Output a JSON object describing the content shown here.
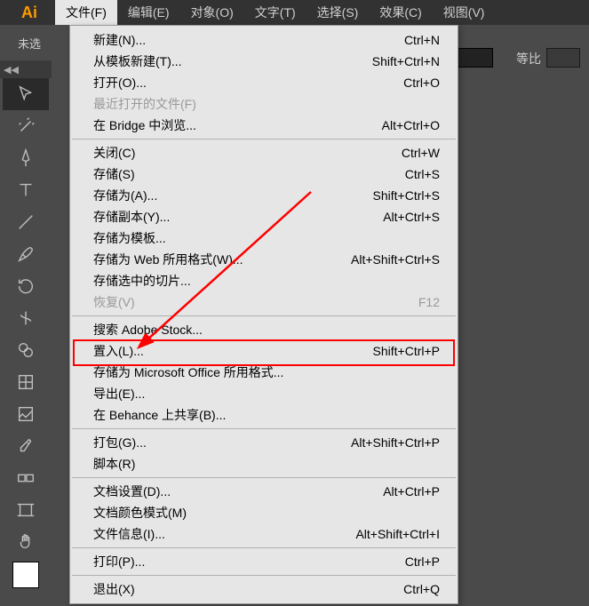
{
  "menubar": {
    "items": [
      "文件(F)",
      "编辑(E)",
      "对象(O)",
      "文字(T)",
      "选择(S)",
      "效果(C)",
      "视图(V)"
    ]
  },
  "secondary": {
    "unselected": "未选",
    "ratio_label": "等比"
  },
  "toolbar_header": "◀◀",
  "dropdown": {
    "items": [
      {
        "label": "新建(N)...",
        "shortcut": "Ctrl+N"
      },
      {
        "label": "从模板新建(T)...",
        "shortcut": "Shift+Ctrl+N"
      },
      {
        "label": "打开(O)...",
        "shortcut": "Ctrl+O"
      },
      {
        "label": "最近打开的文件(F)",
        "shortcut": "",
        "disabled": true
      },
      {
        "label": "在 Bridge 中浏览...",
        "shortcut": "Alt+Ctrl+O"
      },
      {
        "sep": true
      },
      {
        "label": "关闭(C)",
        "shortcut": "Ctrl+W"
      },
      {
        "label": "存储(S)",
        "shortcut": "Ctrl+S"
      },
      {
        "label": "存储为(A)...",
        "shortcut": "Shift+Ctrl+S"
      },
      {
        "label": "存储副本(Y)...",
        "shortcut": "Alt+Ctrl+S"
      },
      {
        "label": "存储为模板...",
        "shortcut": ""
      },
      {
        "label": "存储为 Web 所用格式(W)...",
        "shortcut": "Alt+Shift+Ctrl+S"
      },
      {
        "label": "存储选中的切片...",
        "shortcut": ""
      },
      {
        "label": "恢复(V)",
        "shortcut": "F12",
        "disabled": true
      },
      {
        "sep": true
      },
      {
        "label": "搜索 Adobe Stock...",
        "shortcut": ""
      },
      {
        "label": "置入(L)...",
        "shortcut": "Shift+Ctrl+P",
        "highlight": true
      },
      {
        "label": "存储为 Microsoft Office 所用格式...",
        "shortcut": ""
      },
      {
        "label": "导出(E)...",
        "shortcut": ""
      },
      {
        "label": "在 Behance 上共享(B)...",
        "shortcut": ""
      },
      {
        "sep": true
      },
      {
        "label": "打包(G)...",
        "shortcut": "Alt+Shift+Ctrl+P"
      },
      {
        "label": "脚本(R)",
        "shortcut": ""
      },
      {
        "sep": true
      },
      {
        "label": "文档设置(D)...",
        "shortcut": "Alt+Ctrl+P"
      },
      {
        "label": "文档颜色模式(M)",
        "shortcut": ""
      },
      {
        "label": "文件信息(I)...",
        "shortcut": "Alt+Shift+Ctrl+I"
      },
      {
        "sep": true
      },
      {
        "label": "打印(P)...",
        "shortcut": "Ctrl+P"
      },
      {
        "sep": true
      },
      {
        "label": "退出(X)",
        "shortcut": "Ctrl+Q"
      }
    ]
  },
  "tools": [
    "selection-tool",
    "magic-wand-tool",
    "pen-tool",
    "type-tool",
    "line-tool",
    "paintbrush-tool",
    "rotate-tool",
    "width-tool",
    "shape-builder-tool",
    "mesh-tool",
    "image-trace-tool",
    "eyedropper-tool",
    "blend-tool",
    "column-graph-tool",
    "artboard-tool",
    "hand-tool"
  ]
}
